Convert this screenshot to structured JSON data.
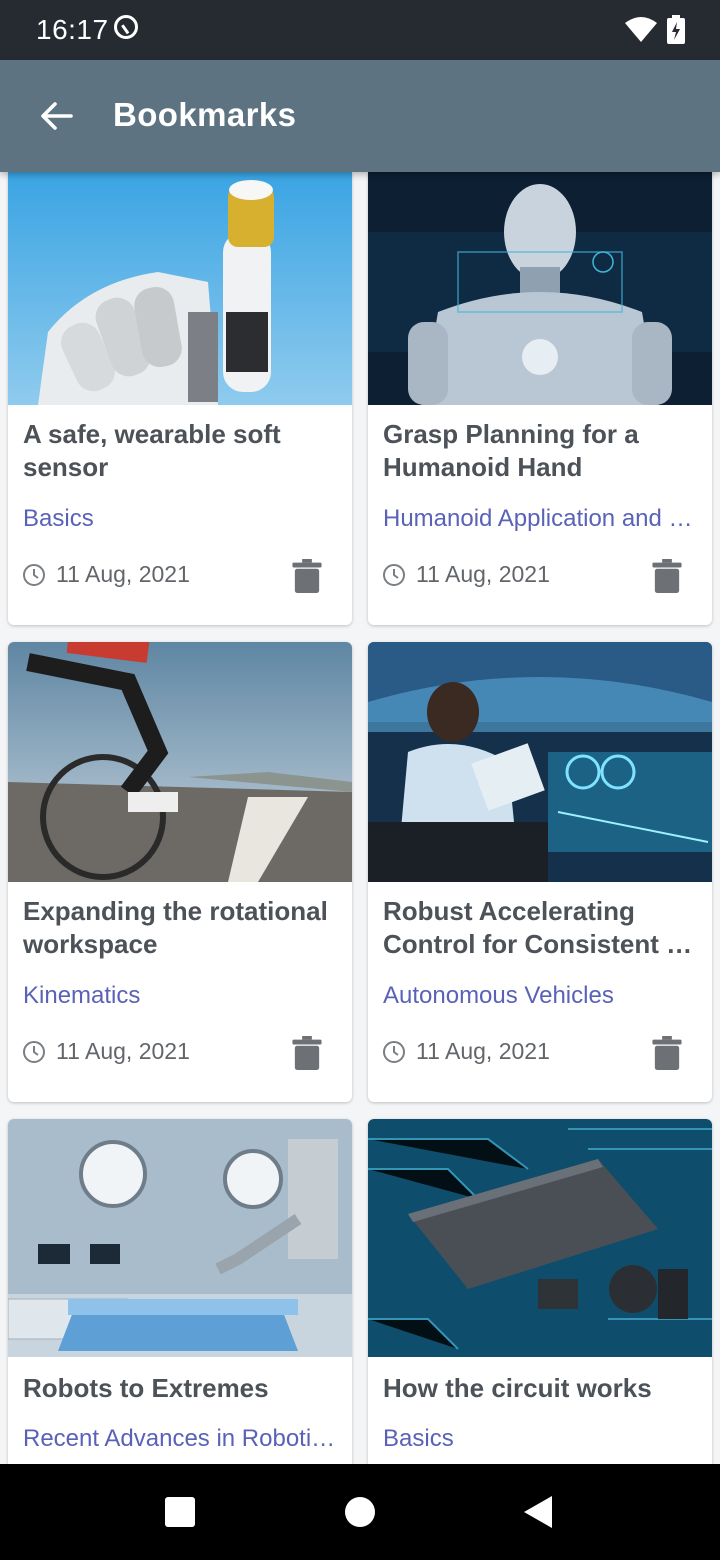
{
  "status_bar": {
    "time": "16:17"
  },
  "app_bar": {
    "title": "Bookmarks"
  },
  "cards": [
    {
      "title": "A safe, wearable soft sensor",
      "category": "Basics",
      "date": "11 Aug, 2021",
      "image": "robot-hand-sensor"
    },
    {
      "title": "Grasp Planning for a Humanoid Hand",
      "category": "Humanoid Application and …",
      "date": "11 Aug, 2021",
      "image": "humanoid-robot"
    },
    {
      "title": "Expanding the rotational workspace",
      "category": "Kinematics",
      "date": "11 Aug, 2021",
      "image": "cyclist-road"
    },
    {
      "title": "Robust Accelerating Control for Consistent …",
      "category": "Autonomous Vehicles",
      "date": "11 Aug, 2021",
      "image": "autonomous-car-interior"
    },
    {
      "title": "Robots to Extremes",
      "category": "Recent Advances in Roboti…",
      "date": "",
      "image": "surgical-robot-room"
    },
    {
      "title": "How the circuit works",
      "category": "Basics",
      "date": "",
      "image": "circuit-board-chip"
    }
  ],
  "colors": {
    "status_bar": "#262b31",
    "app_bar": "#5d7381",
    "category_text": "#5a62b8",
    "title_text": "#4c5258"
  }
}
